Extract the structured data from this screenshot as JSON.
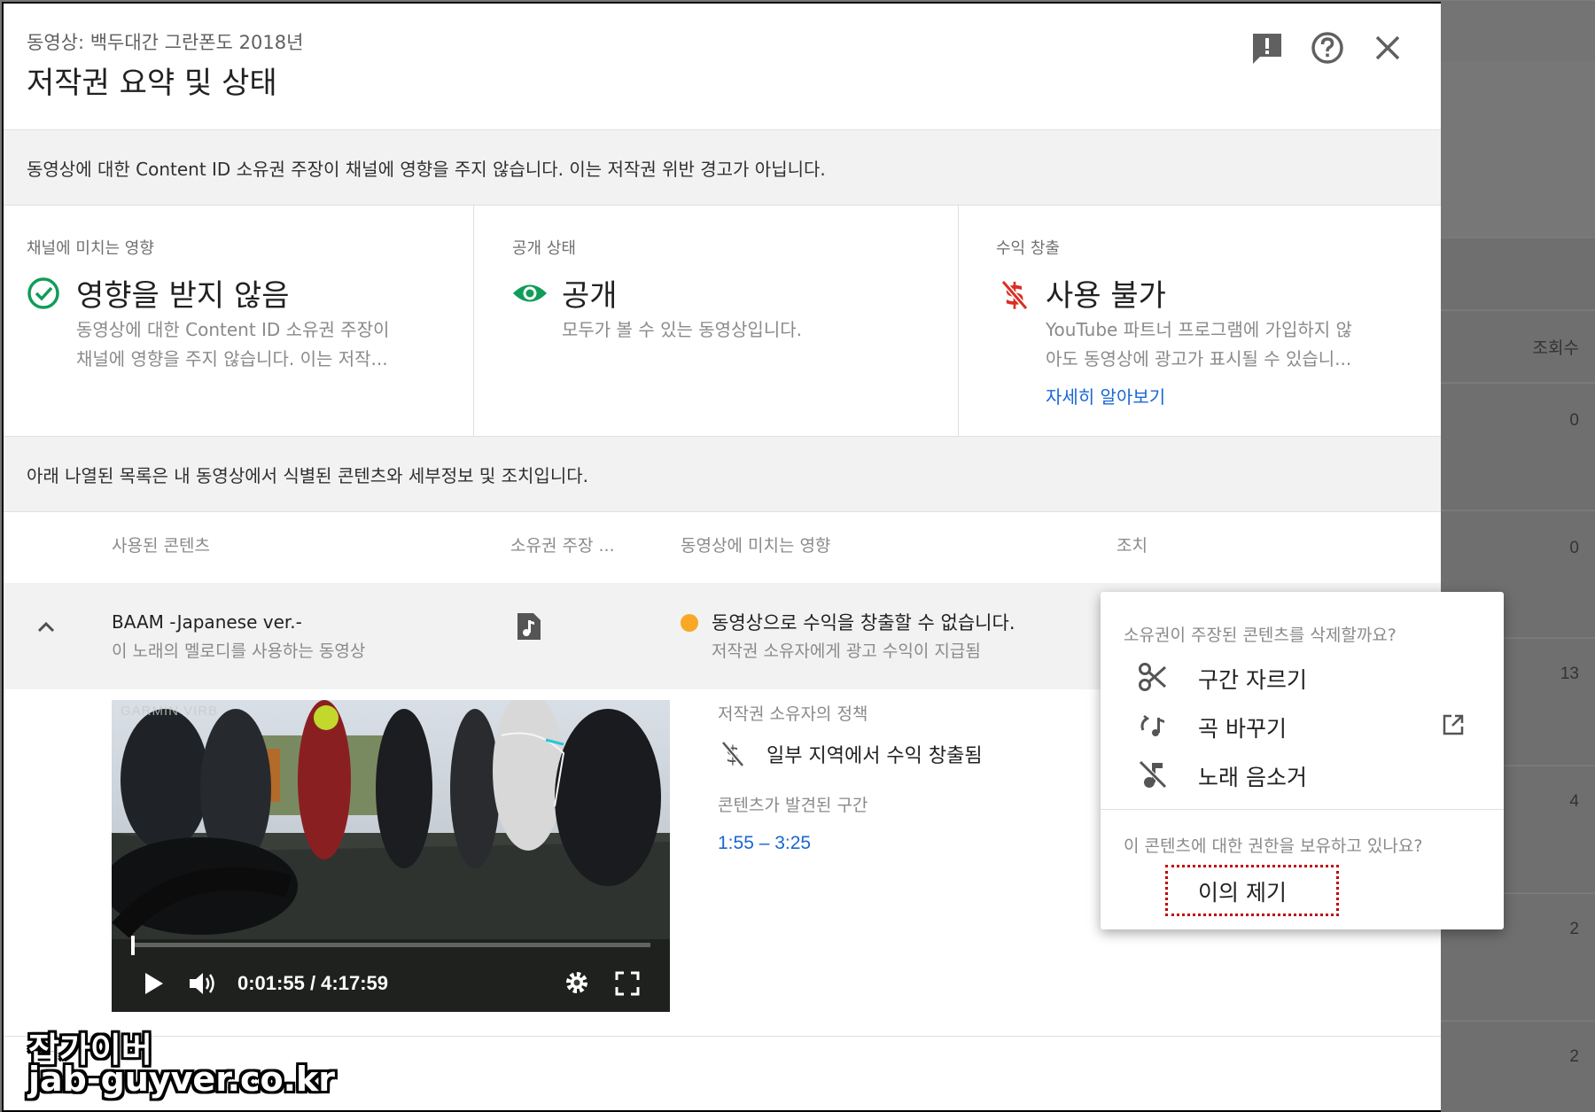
{
  "dialog": {
    "subtitle": "동영상: 백두대간 그란폰도 2018년",
    "title": "저작권 요약 및 상태",
    "icons": [
      "feedback-icon",
      "help-icon",
      "close-icon"
    ]
  },
  "notice": "동영상에 대한 Content ID 소유권 주장이 채널에 영향을 주지 않습니다. 이는 저작권 위반 경고가 아닙니다.",
  "summary": [
    {
      "label": "채널에 미치는 영향",
      "title": "영향을 받지 않음",
      "desc1": "동영상에 대한 Content ID 소유권 주장이",
      "desc2": "채널에 영향을 주지 않습니다. 이는 저작...",
      "icon": "check-circle-icon",
      "color": "#0f9d58"
    },
    {
      "label": "공개 상태",
      "title": "공개",
      "desc1": "모두가 볼 수 있는 동영상입니다.",
      "desc2": "",
      "icon": "eye-icon",
      "color": "#0f9d58"
    },
    {
      "label": "수익 창출",
      "title": "사용 불가",
      "desc1": "YouTube 파트너 프로그램에 가입하지 않",
      "desc2": "아도 동영상에 광고가 표시될 수 있습니...",
      "link": "자세히 알아보기",
      "icon": "no-money-icon",
      "color": "#d93025"
    }
  ],
  "list_intro": "아래 나열된 목록은 내 동영상에서 식별된 콘텐츠와 세부정보 및 조치입니다.",
  "table": {
    "headers": [
      "사용된 콘텐츠",
      "소유권 주장 ...",
      "동영상에 미치는 영향",
      "조치"
    ],
    "row": {
      "content_title": "BAAM -Japanese ver.-",
      "content_sub": "이 노래의 멜로디를 사용하는 동영상",
      "impact_title": "동영상으로 수익을 창출할 수 없습니다.",
      "impact_sub": "저작권 소유자에게 광고 수익이 지급됨",
      "status_color": "#f9a825"
    },
    "detail": {
      "policy_label": "저작권 소유자의 정책",
      "policy_value": "일부 지역에서 수익 창출됨",
      "found_label": "콘텐츠가 발견된 구간",
      "found_range": "1:55 – 3:25"
    }
  },
  "video": {
    "watermark": "GARMIN VIRB",
    "time": "0:01:55 / 4:17:59",
    "progress": 0.0074
  },
  "menu": {
    "question1": "소유권이 주장된 콘텐츠를 삭제할까요?",
    "items": [
      {
        "label": "구간 자르기",
        "icon": "scissors-icon"
      },
      {
        "label": "곡 바꾸기",
        "icon": "swap-music-icon",
        "external": true
      },
      {
        "label": "노래 음소거",
        "icon": "music-off-icon"
      }
    ],
    "question2": "이 콘텐츠에 대한 권한을 보유하고 있나요?",
    "appeal": "이의 제기"
  },
  "background": {
    "column_header": "조회수",
    "values": [
      "0",
      "0",
      "13",
      "4",
      "2",
      "2"
    ]
  },
  "watermark": {
    "line1": "잡가이버",
    "line2": "jab-guyver.co.kr"
  }
}
